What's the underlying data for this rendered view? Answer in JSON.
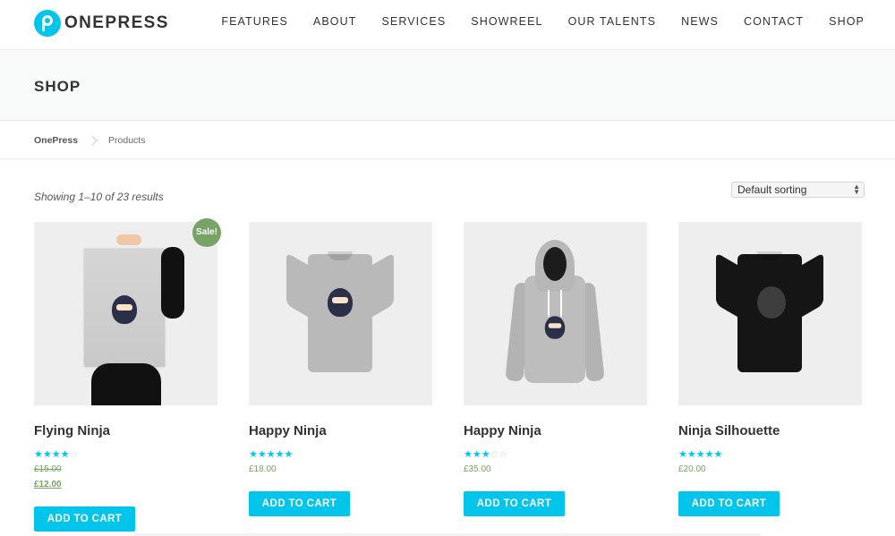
{
  "header": {
    "logo_text": "ONEPRESS",
    "nav": [
      "FEATURES",
      "ABOUT",
      "SERVICES",
      "SHOWREEL",
      "OUR TALENTS",
      "NEWS",
      "CONTACT",
      "SHOP"
    ]
  },
  "page": {
    "title": "SHOP"
  },
  "breadcrumb": {
    "home": "OnePress",
    "current": "Products"
  },
  "shop": {
    "result_count": "Showing 1–10 of 23 results",
    "sorting_selected": "Default sorting"
  },
  "products": [
    {
      "title": "Flying Ninja",
      "rating": 4,
      "badge": "Sale!",
      "old_price": "£15.00",
      "price": "£12.00",
      "button": "ADD TO CART",
      "image": "poster-ninja"
    },
    {
      "title": "Happy Ninja",
      "rating": 5,
      "price": "£18.00",
      "button": "ADD TO CART",
      "image": "grey-tshirt-ninja"
    },
    {
      "title": "Happy Ninja",
      "rating": 3,
      "price": "£35.00",
      "button": "ADD TO CART",
      "image": "grey-hoodie-ninja"
    },
    {
      "title": "Ninja Silhouette",
      "rating": 5,
      "price": "£20.00",
      "button": "ADD TO CART",
      "image": "black-tshirt-ninja-silhouette"
    }
  ],
  "colors": {
    "accent": "#03c4eb",
    "price": "#77a464",
    "sale_badge": "#77a464"
  }
}
